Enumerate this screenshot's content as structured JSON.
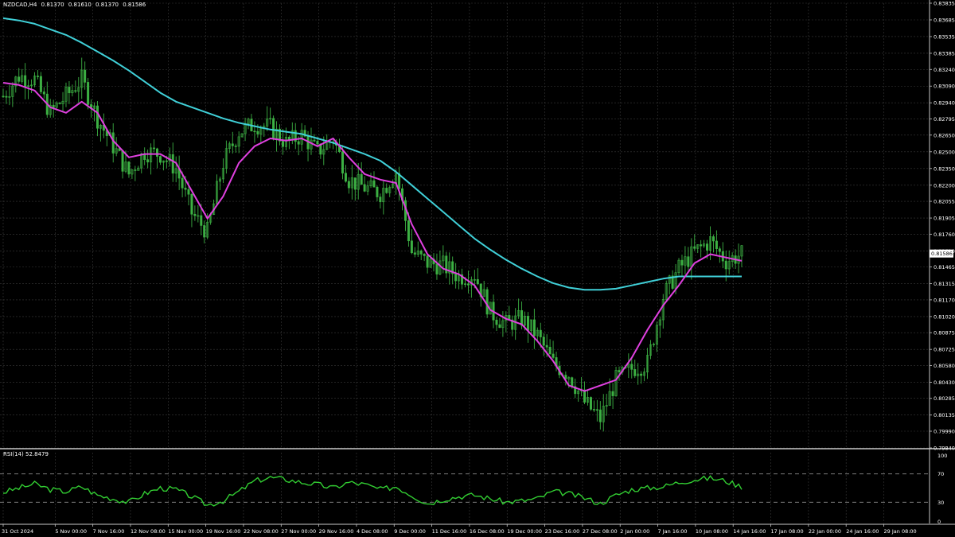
{
  "header": {
    "symbol": "NZDCAD,H4",
    "open": "0.81370",
    "high": "0.81610",
    "low": "0.81370",
    "close": "0.81586"
  },
  "rsi_header": {
    "label": "RSI(14)",
    "value": "52.8479"
  },
  "colors": {
    "background": "#000000",
    "grid": "#3a3a3a",
    "candle": "#3cb043",
    "ma_fast": "#e040e0",
    "ma_slow": "#40d0d8",
    "rsi_line": "#32cd32",
    "axis": "#c8c8c8"
  },
  "chart_data": [
    {
      "type": "candlestick",
      "title": "NZDCAD,H4",
      "grid": true,
      "price_axis_ticks": [
        "0.83835",
        "0.83685",
        "0.83535",
        "0.83385",
        "0.83240",
        "0.83090",
        "0.82940",
        "0.82795",
        "0.82650",
        "0.82500",
        "0.82350",
        "0.82200",
        "0.82055",
        "0.81905",
        "0.81760",
        "0.81610",
        "0.81465",
        "0.81315",
        "0.81170",
        "0.81020",
        "0.80875",
        "0.80725",
        "0.80580",
        "0.80430",
        "0.80285",
        "0.80135",
        "0.79990",
        "0.79840"
      ],
      "current_price": "0.81586",
      "ylim": [
        0.7984,
        0.83835
      ],
      "time_axis_ticks": [
        "31 Oct 2024",
        "5 Nov 00:00",
        "7 Nov 16:00",
        "12 Nov 08:00",
        "15 Nov 00:00",
        "19 Nov 16:00",
        "22 Nov 08:00",
        "27 Nov 00:00",
        "29 Nov 16:00",
        "4 Dec 08:00",
        "9 Dec 00:00",
        "11 Dec 16:00",
        "16 Dec 08:00",
        "19 Dec 00:00",
        "23 Dec 16:00",
        "27 Dec 08:00",
        "2 Jan 00:00",
        "7 Jan 16:00",
        "10 Jan 08:00",
        "14 Jan 16:00",
        "17 Jan 08:00",
        "22 Jan 00:00",
        "24 Jan 16:00",
        "29 Jan 08:00"
      ],
      "close_series": {
        "x_index": [
          0,
          5,
          10,
          15,
          20,
          25,
          30,
          35,
          40,
          45,
          50,
          55,
          60,
          65,
          70,
          75,
          80,
          85,
          90,
          95,
          100,
          105,
          110,
          115,
          120,
          125,
          130,
          135,
          140,
          145,
          150,
          155,
          160,
          165,
          170,
          175,
          180,
          185,
          190,
          195,
          200,
          205,
          210,
          215,
          220,
          225,
          230,
          235
        ],
        "values": [
          0.83,
          0.8318,
          0.8315,
          0.8285,
          0.83,
          0.8315,
          0.828,
          0.8255,
          0.823,
          0.825,
          0.8248,
          0.8235,
          0.8195,
          0.8178,
          0.824,
          0.8268,
          0.8275,
          0.8272,
          0.8258,
          0.8265,
          0.825,
          0.8262,
          0.8225,
          0.8218,
          0.8213,
          0.8232,
          0.816,
          0.815,
          0.8148,
          0.8138,
          0.814,
          0.8106,
          0.8095,
          0.81,
          0.8085,
          0.806,
          0.805,
          0.8025,
          0.801,
          0.8045,
          0.8055,
          0.806,
          0.812,
          0.8145,
          0.816,
          0.817,
          0.8152,
          0.8158
        ]
      },
      "series": [
        {
          "values": [
            0.8312,
            0.831,
            0.8305,
            0.829,
            0.8285,
            0.8295,
            0.8285,
            0.826,
            0.8245,
            0.8248,
            0.8248,
            0.824,
            0.8215,
            0.819,
            0.821,
            0.824,
            0.8255,
            0.8262,
            0.826,
            0.8262,
            0.8255,
            0.8262,
            0.8245,
            0.823,
            0.8225,
            0.8222,
            0.8185,
            0.8158,
            0.8145,
            0.814,
            0.813,
            0.8108,
            0.81,
            0.8095,
            0.808,
            0.8062,
            0.804,
            0.8035,
            0.804,
            0.8045,
            0.8065,
            0.809,
            0.8112,
            0.813,
            0.815,
            0.8158,
            0.8155,
            0.8152
          ]
        },
        {
          "values": [
            0.837,
            0.8368,
            0.8365,
            0.836,
            0.8355,
            0.8348,
            0.834,
            0.8332,
            0.8323,
            0.8313,
            0.8303,
            0.8295,
            0.829,
            0.8285,
            0.828,
            0.8276,
            0.8273,
            0.827,
            0.8268,
            0.8266,
            0.8262,
            0.8258,
            0.8253,
            0.8248,
            0.8242,
            0.8232,
            0.822,
            0.8208,
            0.8196,
            0.8184,
            0.8172,
            0.8162,
            0.8153,
            0.8145,
            0.8138,
            0.8132,
            0.8128,
            0.8126,
            0.8126,
            0.8127,
            0.813,
            0.8133,
            0.8136,
            0.8138,
            0.8138,
            0.8138,
            0.8138,
            0.8138
          ]
        }
      ]
    },
    {
      "type": "line",
      "title": "RSI(14) 52.8479",
      "y_ticks": [
        "100",
        "70",
        "30",
        "0"
      ],
      "ylim": [
        0,
        100
      ],
      "levels": [
        70,
        30
      ],
      "series": [
        {
          "values": [
            44,
            50,
            56,
            48,
            45,
            52,
            40,
            35,
            30,
            42,
            50,
            48,
            38,
            26,
            32,
            45,
            60,
            65,
            62,
            58,
            55,
            50,
            58,
            55,
            48,
            52,
            40,
            28,
            34,
            38,
            40,
            35,
            30,
            32,
            35,
            45,
            42,
            36,
            28,
            40,
            48,
            50,
            52,
            58,
            62,
            64,
            60,
            52
          ]
        }
      ]
    }
  ]
}
